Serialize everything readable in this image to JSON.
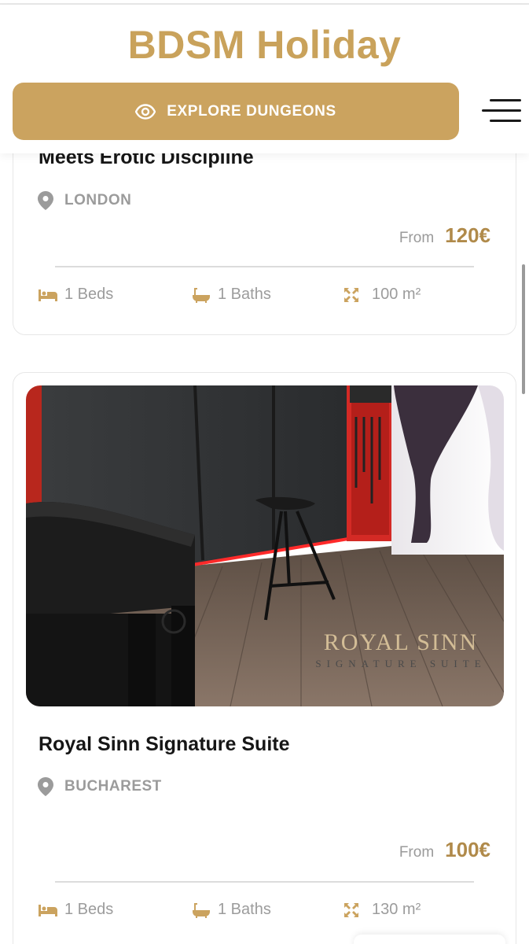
{
  "header": {
    "brand": "BDSM Holiday",
    "explore_label": "EXPLORE DUNGEONS",
    "accent": "#cba35f"
  },
  "listings": [
    {
      "title": "Meets Erotic Discipline",
      "location": "LONDON",
      "price_prefix": "From",
      "price": "120€",
      "beds": "1 Beds",
      "baths": "1 Baths",
      "area": "100 m²"
    },
    {
      "title": "Royal Sinn Signature Suite",
      "location": "BUCHAREST",
      "price_prefix": "From",
      "price": "100€",
      "beds": "1 Beds",
      "baths": "1 Baths",
      "area": "130 m²",
      "photo_watermark": "ROYAL SINN",
      "photo_watermark_sub": "SIGNATURE SUITE"
    }
  ],
  "icons": {
    "explore": "eye-icon",
    "menu": "hamburger-menu-icon",
    "location": "map-pin-icon",
    "beds": "bed-icon",
    "baths": "bathtub-icon",
    "area": "expand-arrows-icon"
  }
}
